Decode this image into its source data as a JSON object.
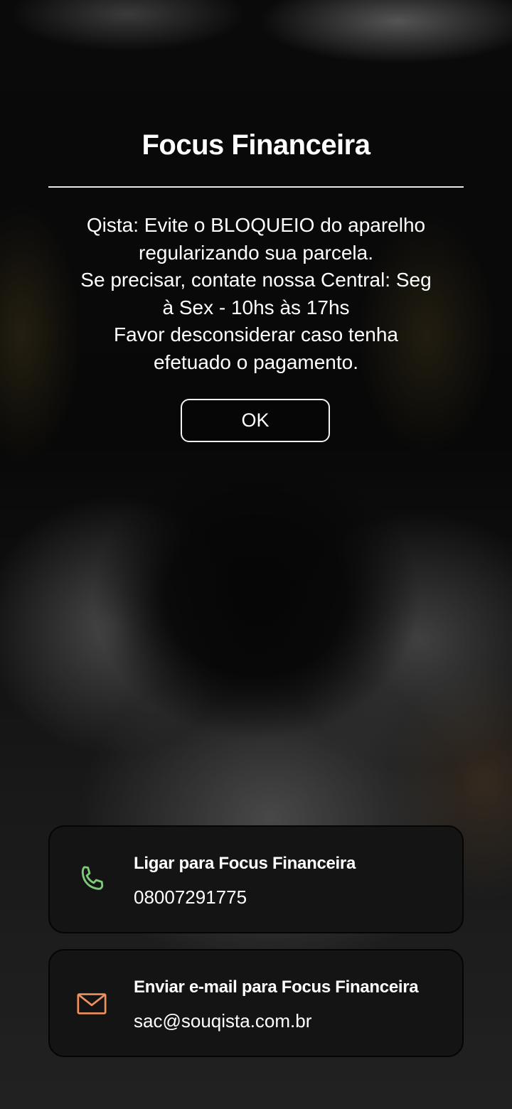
{
  "dialog": {
    "title": "Focus Financeira",
    "message": "Qista: Evite o BLOQUEIO do aparelho\nregularizando sua parcela.\nSe precisar, contate nossa Central: Seg\nà Sex - 10hs às 17hs\nFavor desconsiderar caso tenha\nefetuado o pagamento.",
    "ok_label": "OK"
  },
  "contacts": {
    "call": {
      "title": "Ligar para Focus Financeira",
      "value": "08007291775",
      "icon": "phone-icon",
      "icon_color": "#7fc97a"
    },
    "email": {
      "title": "Enviar e-mail para Focus Financeira",
      "value": "sac@souqista.com.br",
      "icon": "mail-icon",
      "icon_color": "#f0905c"
    }
  }
}
